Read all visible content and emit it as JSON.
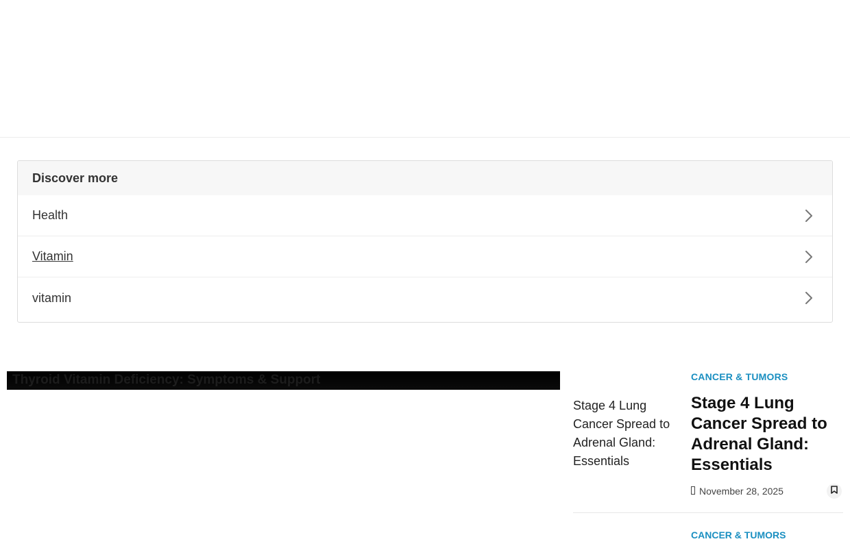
{
  "discover": {
    "heading": "Discover more",
    "items": [
      {
        "label": "Health"
      },
      {
        "label": "Vitamin"
      },
      {
        "label": "vitamin"
      }
    ]
  },
  "video": {
    "title": "Thyroid Vitamin Deficiency: Symptoms & Support"
  },
  "articles": [
    {
      "category": "CANCER & TUMORS",
      "image_alt": "Stage 4 Lung Cancer Spread to Adrenal Gland: Essentials",
      "title": "Stage 4 Lung Cancer Spread to Adrenal Gland: Essentials",
      "date": "November 28, 2025"
    },
    {
      "category": "CANCER & TUMORS"
    }
  ],
  "icons": {
    "chevron": "chevron-right-icon",
    "calendar": "calendar-icon",
    "bookmark": "bookmark-icon"
  },
  "colors": {
    "category": "#1a8fc1",
    "video_bg": "#000000"
  }
}
